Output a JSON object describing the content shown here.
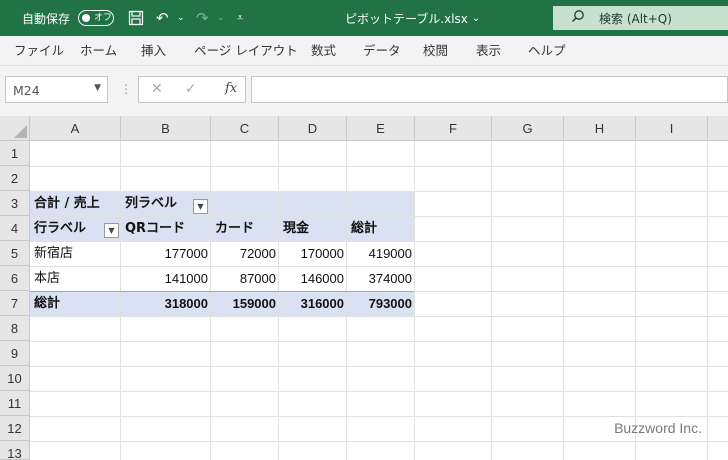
{
  "titlebar": {
    "autosave_label": "自動保存",
    "autosave_state": "オフ",
    "doc_title": "ピボットテーブル.xlsx",
    "search_placeholder": "検索 (Alt+Q)",
    "accent_color": "#217346"
  },
  "ribbon": {
    "tabs": [
      "ファイル",
      "ホーム",
      "挿入",
      "ページ レイアウト",
      "数式",
      "データ",
      "校閲",
      "表示",
      "ヘルプ"
    ]
  },
  "formula_bar": {
    "name_box": "M24",
    "fx_label": "fx",
    "formula": ""
  },
  "grid": {
    "columns": [
      "A",
      "B",
      "C",
      "D",
      "E",
      "F",
      "G",
      "H",
      "I"
    ],
    "rows": [
      "1",
      "2",
      "3",
      "4",
      "5",
      "6",
      "7",
      "8",
      "9",
      "10",
      "11",
      "12",
      "13"
    ]
  },
  "pivot": {
    "value_field": "合計 / 売上",
    "column_labels": "列ラベル",
    "row_labels": "行ラベル",
    "headers": [
      "QRコード",
      "カード",
      "現金",
      "総計"
    ],
    "rows": [
      {
        "label": "新宿店",
        "values": [
          "177000",
          "72000",
          "170000",
          "419000"
        ]
      },
      {
        "label": "本店",
        "values": [
          "141000",
          "87000",
          "146000",
          "374000"
        ]
      }
    ],
    "total": {
      "label": "総計",
      "values": [
        "318000",
        "159000",
        "316000",
        "793000"
      ]
    },
    "band_color": "#d9e1f2"
  },
  "watermark": "Buzzword Inc."
}
